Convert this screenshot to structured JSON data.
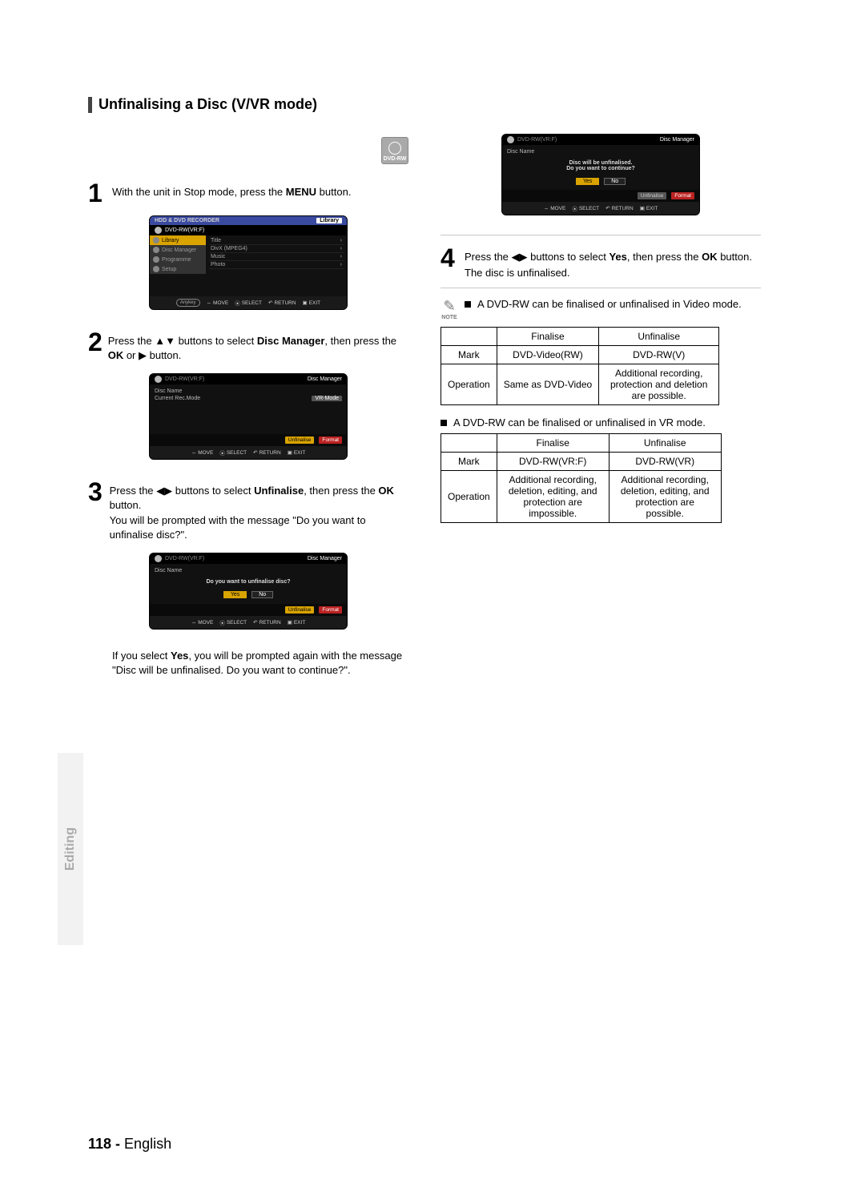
{
  "header": {
    "title": "Unfinalising a Disc (V/VR mode)"
  },
  "disc_badge": {
    "label": "DVD-RW"
  },
  "steps": {
    "s1": {
      "num": "1",
      "text_a": "With the unit in Stop mode, press the ",
      "text_b": "MENU",
      "text_c": " button."
    },
    "s2": {
      "num": "2",
      "text_a": "Press the ",
      "text_b": " buttons to select ",
      "text_c": "Disc Manager",
      "text_d": ", then press the ",
      "text_e": "OK",
      "text_f": " or ",
      "text_g": " button."
    },
    "s3": {
      "num": "3",
      "text_a": "Press the ",
      "text_b": " buttons to select ",
      "text_c": "Unfinalise",
      "text_d": ", then press the ",
      "text_e": "OK",
      "text_f": " button.",
      "text_g": "You will be prompted with the message \"Do you want to unfinalise disc?\"."
    },
    "s3b": {
      "text_a": "If you select ",
      "text_b": "Yes",
      "text_c": ", you will be prompted again with the message \"Disc will be unfinalised. Do you want to continue?\"."
    },
    "s4": {
      "num": "4",
      "text_a": "Press the ",
      "text_b": " buttons to select ",
      "text_c": "Yes",
      "text_d": ", then press the ",
      "text_e": "OK",
      "text_f": " button.",
      "text_g": "The disc is unfinalised."
    }
  },
  "osd1": {
    "top": "HDD & DVD RECORDER",
    "top_r": "Library",
    "hdr": "DVD-RW(VR:F)",
    "menu": [
      "Library",
      "Disc Manager",
      "Programme",
      "Setup"
    ],
    "list": [
      "Title",
      "DivX (MPEG4)",
      "Music",
      "Photo"
    ],
    "anykey": "Anykey",
    "legend": {
      "move": "MOVE",
      "select": "SELECT",
      "return": "RETURN",
      "exit": "EXIT"
    }
  },
  "osd2": {
    "hdr": "DVD-RW(VR:F)",
    "dm": "Disc Manager",
    "r1l": "Disc Name",
    "r2l": "Current Rec.Mode",
    "r2v": "VR-Mode",
    "btn1": "Unfinalise",
    "btn2": "Format",
    "legend": {
      "move": "MOVE",
      "select": "SELECT",
      "return": "RETURN",
      "exit": "EXIT"
    }
  },
  "osd3": {
    "hdr": "DVD-RW(VR:F)",
    "dm": "Disc Manager",
    "r1l": "Disc Name",
    "msg": "Do you want to unfinalise disc?",
    "yes": "Yes",
    "no": "No",
    "btn1": "Unfinalise",
    "btn2": "Format",
    "legend": {
      "move": "MOVE",
      "select": "SELECT",
      "return": "RETURN",
      "exit": "EXIT"
    }
  },
  "osd4": {
    "hdr": "DVD-RW(VR:F)",
    "dm": "Disc Manager",
    "r1l": "Disc Name",
    "msg1": "Disc will be unfinalised.",
    "msg2": "Do you want to continue?",
    "yes": "Yes",
    "no": "No",
    "btn1": "Unfinalise",
    "btn2": "Format",
    "legend": {
      "move": "MOVE",
      "select": "SELECT",
      "return": "RETURN",
      "exit": "EXIT"
    }
  },
  "note": {
    "label": "NOTE",
    "b1": "A DVD-RW can be finalised or unfinalised in Video mode.",
    "b2": "A DVD-RW can be finalised or unfinalised in VR mode."
  },
  "table1": {
    "h1": "Finalise",
    "h2": "Unfinalise",
    "r1l": "Mark",
    "r1a": "DVD-Video(RW)",
    "r1b": "DVD-RW(V)",
    "r2l": "Operation",
    "r2a": "Same as DVD-Video",
    "r2b": "Additional recording, protection and deletion are possible."
  },
  "table2": {
    "h1": "Finalise",
    "h2": "Unfinalise",
    "r1l": "Mark",
    "r1a": "DVD-RW(VR:F)",
    "r1b": "DVD-RW(VR)",
    "r2l": "Operation",
    "r2a": "Additional recording, deletion, editing, and protection are impossible.",
    "r2b": "Additional recording, deletion, editing, and protection are possible."
  },
  "side_tab": "Editing",
  "footer": {
    "page": "118 -",
    "lang": " English"
  }
}
